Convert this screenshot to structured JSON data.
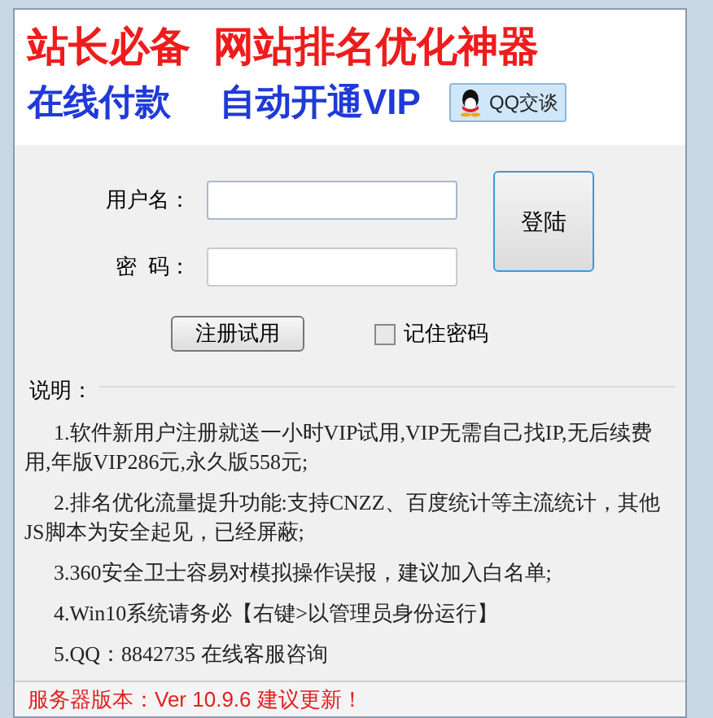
{
  "header": {
    "slogans": [
      "站长必备",
      "网站排名优化神器"
    ],
    "taglines": [
      "在线付款",
      "自动开通VIP"
    ],
    "qq_button": "QQ交谈"
  },
  "login": {
    "username_label": "用户名：",
    "password_label": "密  码：",
    "login_button": "登陆",
    "register_button": "注册试用",
    "remember": {
      "label": "记住密码",
      "checked": false
    }
  },
  "notes": {
    "title": "说明：",
    "items": [
      "1.软件新用户注册就送一小时VIP试用,VIP无需自己找IP,无后续费用,年版VIP286元,永久版558元;",
      "2.排名优化流量提升功能:支持CNZZ、百度统计等主流统计，其他JS脚本为安全起见，已经屏蔽;",
      "3.360安全卫士容易对模拟操作误报，建议加入白名单;",
      "4.Win10系统请务必【右键>以管理员身份运行】",
      "5.QQ：8842735 在线客服咨询"
    ]
  },
  "status_bar": "服务器版本：Ver 10.9.6 建议更新！"
}
